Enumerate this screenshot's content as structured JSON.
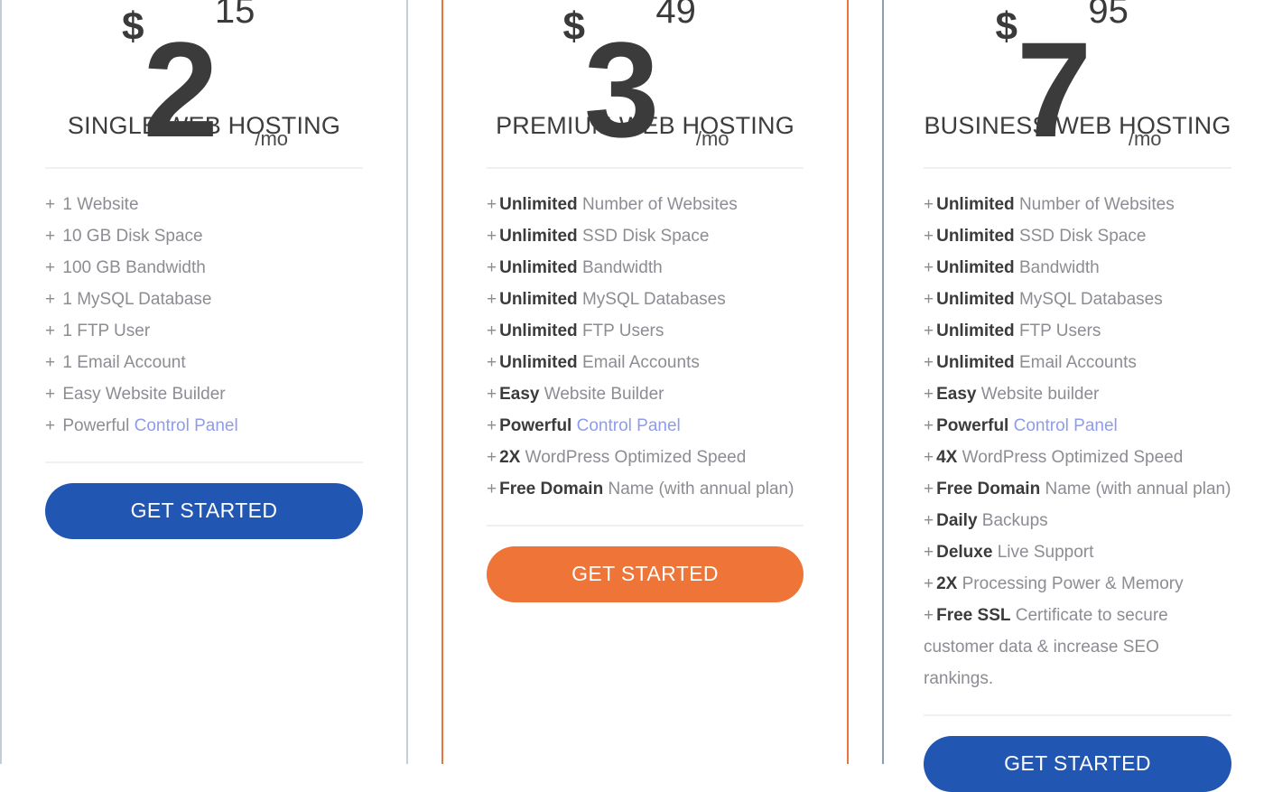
{
  "colors": {
    "cta_blue": "#2256b3",
    "cta_orange": "#ee7437",
    "border_gray": "#c3ced6",
    "border_orange": "#e8763a",
    "link_blue": "#8e9cea",
    "feature_text": "#8c8c93",
    "heading_text": "#3d3d3d"
  },
  "plans": [
    {
      "id": "single",
      "currency": "$",
      "amount": "2",
      "cents": "15",
      "per": "/mo",
      "title": "SINGLE WEB HOSTING",
      "cta_label": "GET STARTED",
      "cta_style": "blue",
      "features": [
        {
          "plus": "+",
          "strong": "",
          "text": "1 Website"
        },
        {
          "plus": "+",
          "strong": "",
          "text": "10 GB Disk Space"
        },
        {
          "plus": "+",
          "strong": "",
          "text": "100 GB Bandwidth"
        },
        {
          "plus": "+",
          "strong": "",
          "text": "1 MySQL Database"
        },
        {
          "plus": "+",
          "strong": "",
          "text": "1 FTP User"
        },
        {
          "plus": "+",
          "strong": "",
          "text": "1 Email Account"
        },
        {
          "plus": "+",
          "strong": "",
          "text": "Easy Website Builder"
        },
        {
          "plus": "+",
          "strong": "",
          "text": "Powerful ",
          "link": "Control Panel"
        }
      ]
    },
    {
      "id": "premium",
      "currency": "$",
      "amount": "3",
      "cents": "49",
      "per": "/mo",
      "title": "PREMIUM WEB HOSTING",
      "cta_label": "GET STARTED",
      "cta_style": "orange",
      "features": [
        {
          "plus": "+",
          "strong": "Unlimited",
          "text": " Number of Websites"
        },
        {
          "plus": "+",
          "strong": "Unlimited",
          "text": " SSD Disk Space"
        },
        {
          "plus": "+",
          "strong": "Unlimited",
          "text": " Bandwidth"
        },
        {
          "plus": "+",
          "strong": "Unlimited",
          "text": " MySQL Databases"
        },
        {
          "plus": "+",
          "strong": "Unlimited",
          "text": " FTP Users"
        },
        {
          "plus": "+",
          "strong": "Unlimited",
          "text": " Email Accounts"
        },
        {
          "plus": "+",
          "strong": "Easy",
          "text": " Website Builder"
        },
        {
          "plus": "+",
          "strong": "Powerful",
          "text": " ",
          "link": "Control Panel"
        },
        {
          "plus": "+",
          "strong": "2X",
          "text": " WordPress Optimized Speed"
        },
        {
          "plus": "+",
          "strong": "Free Domain",
          "text": " Name (with annual plan)"
        }
      ]
    },
    {
      "id": "business",
      "currency": "$",
      "amount": "7",
      "cents": "95",
      "per": "/mo",
      "title": "BUSINESS WEB HOSTING",
      "cta_label": "GET STARTED",
      "cta_style": "blue",
      "features": [
        {
          "plus": "+",
          "strong": "Unlimited",
          "text": " Number of Websites"
        },
        {
          "plus": "+",
          "strong": "Unlimited",
          "text": " SSD Disk Space"
        },
        {
          "plus": "+",
          "strong": "Unlimited",
          "text": " Bandwidth"
        },
        {
          "plus": "+",
          "strong": "Unlimited",
          "text": " MySQL Databases"
        },
        {
          "plus": "+",
          "strong": "Unlimited",
          "text": " FTP Users"
        },
        {
          "plus": "+",
          "strong": "Unlimited",
          "text": " Email Accounts"
        },
        {
          "plus": "+",
          "strong": "Easy",
          "text": " Website builder"
        },
        {
          "plus": "+",
          "strong": "Powerful",
          "text": " ",
          "link": "Control Panel"
        },
        {
          "plus": "+",
          "strong": "4X",
          "text": " WordPress Optimized Speed"
        },
        {
          "plus": "+",
          "strong": "Free Domain",
          "text": " Name (with annual plan)"
        },
        {
          "plus": "+",
          "strong": "Daily",
          "text": " Backups"
        },
        {
          "plus": "+",
          "strong": "Deluxe",
          "text": " Live Support"
        },
        {
          "plus": "+",
          "strong": "2X",
          "text": " Processing Power & Memory"
        },
        {
          "plus": "+",
          "strong": "Free SSL",
          "text": " Certificate to secure customer data & increase SEO rankings."
        }
      ]
    }
  ]
}
